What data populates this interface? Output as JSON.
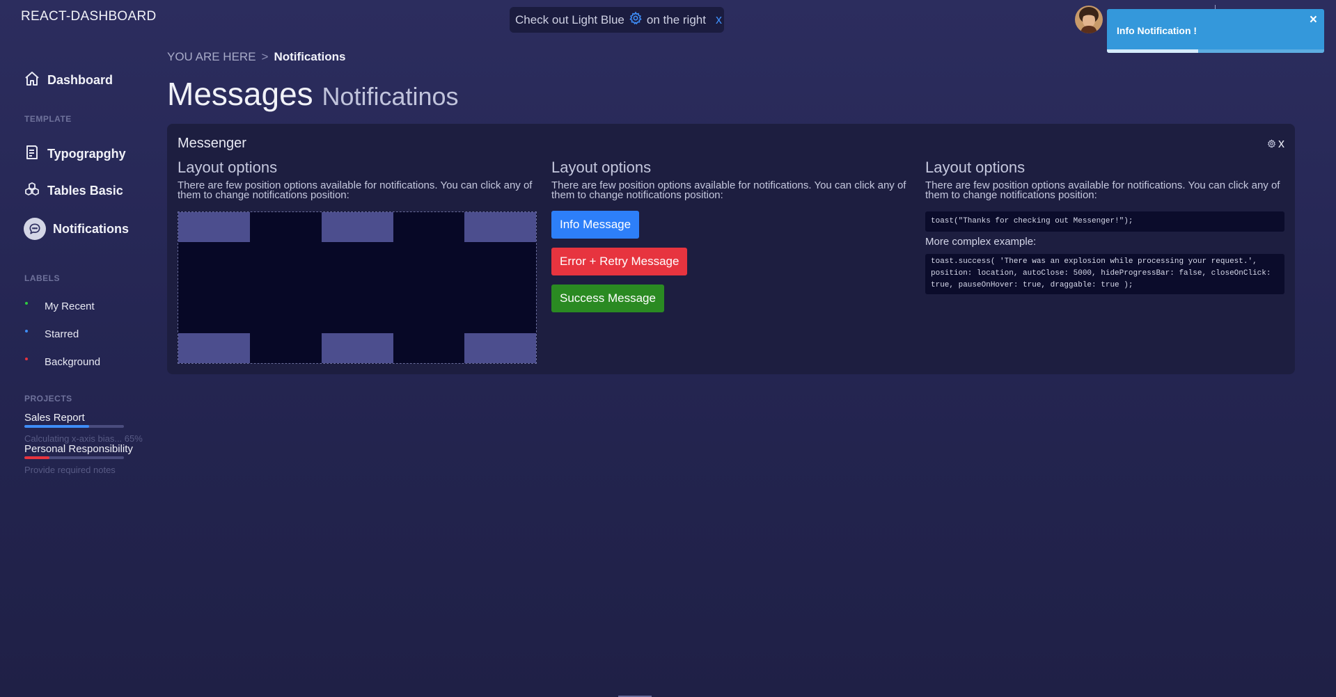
{
  "sidebar": {
    "logo": "REACT-DASHBOARD",
    "nav": {
      "dashboard": "Dashboard",
      "typography": "Typograpghy",
      "tables": "Tables Basic",
      "notifications": "Notifications"
    },
    "sections": {
      "template": "TEMPLATE",
      "labels": "LABELS",
      "projects": "PROJECTS"
    },
    "labels": [
      {
        "label": "My Recent",
        "color": "#2ecc40"
      },
      {
        "label": "Starred",
        "color": "#3e8df7"
      },
      {
        "label": "Background",
        "color": "#e7343f"
      }
    ],
    "projects": [
      {
        "name": "Sales Report",
        "description": "Calculating x-axis bias... 65%",
        "progress": 0.65,
        "color": "#3e8df7"
      },
      {
        "name": "Personal Responsibility",
        "description": "Provide required notes",
        "progress": 0.25,
        "color": "#e7343f"
      }
    ]
  },
  "helper": {
    "text_before": "Check out Light Blue",
    "text_after": "on the right",
    "close": "x"
  },
  "toast": {
    "message": "Info Notification !",
    "close": "×",
    "progress": 0.42
  },
  "breadcrumb": {
    "prefix": "YOU ARE HERE",
    "separator": ">",
    "current": "Notifications"
  },
  "page": {
    "title": "Messages",
    "subtitle": "Notificatinos"
  },
  "panel": {
    "title": "Messenger",
    "close": "x",
    "columns": [
      {
        "heading": "Layout options",
        "description": "There are few position options available for notifications. You can click any of them to change notifications position:"
      },
      {
        "heading": "Layout options",
        "description": "There are few position options available for notifications. You can click any of them to change notifications position:"
      },
      {
        "heading": "Layout options",
        "description": "There are few position options available for notifications. You can click any of them to change notifications position:"
      }
    ],
    "buttons": {
      "info": "Info Message",
      "error": "Error + Retry Message",
      "success": "Success Message"
    },
    "code_simple": "toast(\"Thanks for checking out Messenger!\");",
    "more_label": "More complex example:",
    "code_complex": "toast.success( 'There was an explosion while processing your request.', position: location, autoClose: 5000, hideProgressBar: false, closeOnClick: true, pauseOnHover: true, draggable: true );"
  },
  "colors": {
    "info": "#2d7ff9",
    "error": "#e7343f",
    "success": "#2a8a22",
    "toast": "#3498db"
  }
}
